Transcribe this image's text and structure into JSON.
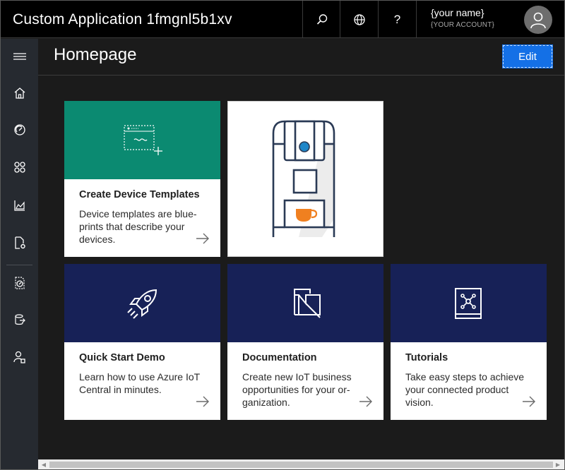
{
  "app": {
    "title": "Custom Application 1fmgnl5b1xv"
  },
  "topbar": {
    "help_label": "?",
    "account_name": "{your name}",
    "account_sub": "{YOUR ACCOUNT}"
  },
  "page": {
    "title": "Homepage",
    "edit_label": "Edit"
  },
  "tiles": [
    {
      "title": "Create Device Templates",
      "desc": "Device templates are blue-prints that describe your devices.",
      "header_color": "#0b8a71"
    },
    {
      "title": "",
      "desc": ""
    },
    {
      "title": "Quick Start Demo",
      "desc": "Learn how to use Azure IoT Central in minutes.",
      "header_color": "#172157"
    },
    {
      "title": "Documentation",
      "desc": "Create new IoT business opportunities for your or-ganization.",
      "header_color": "#172157"
    },
    {
      "title": "Tutorials",
      "desc": "Take easy steps to achieve your connected product vision.",
      "header_color": "#172157"
    }
  ],
  "colors": {
    "accent": "#1470e6",
    "topbar": "#000000",
    "nav": "#262a30",
    "content_bg": "#1b1b1b",
    "coffee_cup": "#f08020",
    "coffee_button": "#1e86c8"
  },
  "icons": [
    "menu-icon",
    "home-icon",
    "dashboard-icon",
    "device-sets-icon",
    "analytics-icon",
    "jobs-icon",
    "device-templates-icon",
    "data-export-icon",
    "administration-icon",
    "search-icon",
    "globe-icon",
    "help-icon",
    "person-icon",
    "arrow-right-icon",
    "rocket-icon",
    "folder-icon",
    "book-network-icon",
    "template-icon"
  ]
}
